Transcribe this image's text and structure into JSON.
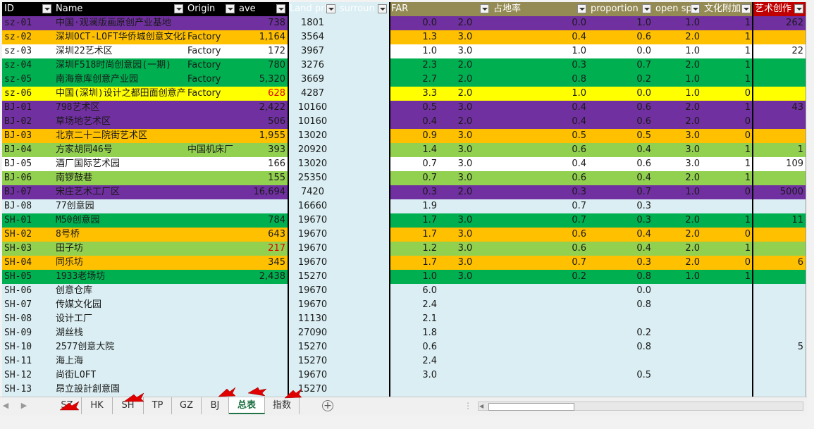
{
  "colors": {
    "purple": "#7030a0",
    "orange": "#ffc000",
    "white": "#ffffff",
    "green": "#00b050",
    "yellow": "#ffff00",
    "light_green": "#92d050",
    "light_blue": "#daeef3",
    "header_black": "#000000",
    "header_olive": "#948a54",
    "header_darkred": "#c00000",
    "red_text": "#e00000"
  },
  "headers": [
    {
      "label": "ID",
      "bg": "#000000",
      "filter": true
    },
    {
      "label": "Name",
      "bg": "#000000",
      "filter": true
    },
    {
      "label": "Origin",
      "bg": "#000000",
      "filter": true
    },
    {
      "label": "ave",
      "bg": "#000000",
      "filter": true
    },
    {
      "label": "Land pric",
      "bg": "#daeef3",
      "filter": true
    },
    {
      "label": "surroun",
      "bg": "#daeef3",
      "filter": true
    },
    {
      "label": "FAR",
      "bg": "#948a54",
      "filter": false
    },
    {
      "label": "",
      "bg": "#948a54",
      "filter": true
    },
    {
      "label": "占地率",
      "bg": "#948a54",
      "filter": true
    },
    {
      "label": "proportion",
      "bg": "#948a54",
      "filter": true
    },
    {
      "label": "open sp",
      "bg": "#948a54",
      "filter": true
    },
    {
      "label": "文化附加",
      "bg": "#948a54",
      "filter": true
    },
    {
      "label": "艺术创作",
      "bg": "#c00000",
      "filter": true
    }
  ],
  "rows": [
    {
      "bg": "#7030a0",
      "cells": [
        "sz-01",
        "中国·观澜版画原创产业基地",
        "",
        "738",
        "1801",
        "",
        "0.0",
        "2.0",
        "0.0",
        "1.0",
        "1.0",
        "1",
        "262"
      ]
    },
    {
      "bg": "#ffc000",
      "cells": [
        "sz-02",
        "深圳OCT-LOFT华侨城创意文化园",
        "Factory",
        "1,164",
        "3564",
        "",
        "1.3",
        "3.0",
        "0.4",
        "0.6",
        "2.0",
        "1",
        ""
      ]
    },
    {
      "bg": "#ffffff",
      "cells": [
        "sz-03",
        "深圳22艺术区",
        "Factory",
        "172",
        "3967",
        "",
        "1.0",
        "3.0",
        "1.0",
        "0.0",
        "1.0",
        "1",
        "22"
      ]
    },
    {
      "bg": "#00b050",
      "cells": [
        "sz-04",
        "深圳F518时尚创意园(一期)",
        "Factory",
        "780",
        "3276",
        "",
        "2.3",
        "2.0",
        "0.3",
        "0.7",
        "2.0",
        "1",
        ""
      ]
    },
    {
      "bg": "#00b050",
      "cells": [
        "sz-05",
        "南海意库创意产业园",
        "Factory",
        "5,320",
        "3669",
        "",
        "2.7",
        "2.0",
        "0.8",
        "0.2",
        "1.0",
        "1",
        ""
      ]
    },
    {
      "bg": "#ffff00",
      "red": [
        3
      ],
      "cells": [
        "sz-06",
        "中国(深圳)设计之都田面创意产业园",
        "Factory",
        "628",
        "4287",
        "",
        "3.3",
        "2.0",
        "1.0",
        "0.0",
        "1.0",
        "0",
        ""
      ]
    },
    {
      "bg": "#7030a0",
      "cells": [
        "BJ-01",
        "798艺术区",
        "",
        "2,422",
        "10160",
        "",
        "0.5",
        "3.0",
        "0.4",
        "0.6",
        "2.0",
        "1",
        "43"
      ]
    },
    {
      "bg": "#7030a0",
      "cells": [
        "BJ-02",
        "草场地艺术区",
        "",
        "506",
        "10160",
        "",
        "0.4",
        "2.0",
        "0.4",
        "0.6",
        "2.0",
        "0",
        ""
      ]
    },
    {
      "bg": "#ffc000",
      "cells": [
        "BJ-03",
        "北京二十二院街艺术区",
        "",
        "1,955",
        "13020",
        "",
        "0.9",
        "3.0",
        "0.5",
        "0.5",
        "3.0",
        "0",
        ""
      ]
    },
    {
      "bg": "#92d050",
      "cells": [
        "BJ-04",
        "方家胡同46号",
        "中国机床厂",
        "393",
        "20920",
        "",
        "1.4",
        "3.0",
        "0.6",
        "0.4",
        "3.0",
        "1",
        "1"
      ]
    },
    {
      "bg": "#ffffff",
      "cells": [
        "BJ-05",
        "酒厂国际艺术园",
        "",
        "166",
        "13020",
        "",
        "0.7",
        "3.0",
        "0.4",
        "0.6",
        "3.0",
        "1",
        "109"
      ]
    },
    {
      "bg": "#92d050",
      "cells": [
        "BJ-06",
        "南锣鼓巷",
        "",
        "155",
        "25350",
        "",
        "0.7",
        "3.0",
        "0.6",
        "0.4",
        "2.0",
        "1",
        ""
      ]
    },
    {
      "bg": "#7030a0",
      "cells": [
        "BJ-07",
        "宋庄艺术工厂区",
        "",
        "16,694",
        "7420",
        "",
        "0.3",
        "2.0",
        "0.3",
        "0.7",
        "1.0",
        "0",
        "5000"
      ]
    },
    {
      "bg": "#daeef3",
      "cells": [
        "BJ-08",
        "77创意园",
        "",
        "",
        "16660",
        "",
        "1.9",
        "",
        "0.7",
        "0.3",
        "",
        "",
        ""
      ]
    },
    {
      "bg": "#00b050",
      "cells": [
        "SH-01",
        "M50创意园",
        "",
        "784",
        "19670",
        "",
        "1.7",
        "3.0",
        "0.7",
        "0.3",
        "2.0",
        "1",
        "11"
      ]
    },
    {
      "bg": "#ffc000",
      "cells": [
        "SH-02",
        "8号桥",
        "",
        "643",
        "19670",
        "",
        "1.7",
        "3.0",
        "0.6",
        "0.4",
        "2.0",
        "0",
        ""
      ]
    },
    {
      "bg": "#92d050",
      "red": [
        3
      ],
      "cells": [
        "SH-03",
        "田子坊",
        "",
        "217",
        "19670",
        "",
        "1.2",
        "3.0",
        "0.6",
        "0.4",
        "2.0",
        "1",
        ""
      ]
    },
    {
      "bg": "#ffc000",
      "cells": [
        "SH-04",
        "同乐坊",
        "",
        "345",
        "19670",
        "",
        "1.7",
        "3.0",
        "0.7",
        "0.3",
        "2.0",
        "0",
        "6"
      ]
    },
    {
      "bg": "#00b050",
      "cells": [
        "SH-05",
        "1933老场坊",
        "",
        "2,438",
        "15270",
        "",
        "1.0",
        "3.0",
        "0.2",
        "0.8",
        "1.0",
        "1",
        ""
      ]
    },
    {
      "bg": "#daeef3",
      "cells": [
        "SH-06",
        "创意仓库",
        "",
        "",
        "19670",
        "",
        "6.0",
        "",
        "",
        "0.0",
        "",
        "",
        ""
      ]
    },
    {
      "bg": "#daeef3",
      "cells": [
        "SH-07",
        "传媒文化园",
        "",
        "",
        "19670",
        "",
        "2.4",
        "",
        "",
        "0.8",
        "",
        "",
        ""
      ]
    },
    {
      "bg": "#daeef3",
      "cells": [
        "SH-08",
        "设计工厂",
        "",
        "",
        "11130",
        "",
        "2.1",
        "",
        "",
        "",
        "",
        "",
        ""
      ]
    },
    {
      "bg": "#daeef3",
      "cells": [
        "SH-09",
        "湖丝栈",
        "",
        "",
        "27090",
        "",
        "1.8",
        "",
        "",
        "0.2",
        "",
        "",
        ""
      ]
    },
    {
      "bg": "#daeef3",
      "cells": [
        "SH-10",
        "2577创意大院",
        "",
        "",
        "15270",
        "",
        "0.6",
        "",
        "",
        "0.8",
        "",
        "",
        "5"
      ]
    },
    {
      "bg": "#daeef3",
      "cells": [
        "SH-11",
        "海上海",
        "",
        "",
        "15270",
        "",
        "2.4",
        "",
        "",
        "",
        "",
        "",
        ""
      ]
    },
    {
      "bg": "#daeef3",
      "cells": [
        "SH-12",
        "尚街LOFT",
        "",
        "",
        "19670",
        "",
        "3.0",
        "",
        "",
        "0.5",
        "",
        "",
        ""
      ]
    },
    {
      "bg": "#daeef3",
      "cells": [
        "SH-13",
        "昂立設計創意園",
        "",
        "",
        "15270",
        "",
        "",
        "",
        "",
        "",
        "",
        "",
        ""
      ]
    }
  ],
  "tabs": [
    {
      "label": "SZ",
      "active": false
    },
    {
      "label": "HK",
      "active": false
    },
    {
      "label": "SH",
      "active": false
    },
    {
      "label": "TP",
      "active": false
    },
    {
      "label": "GZ",
      "active": false
    },
    {
      "label": "BJ",
      "active": false
    },
    {
      "label": "总表",
      "active": true
    },
    {
      "label": "指数",
      "active": false
    }
  ],
  "icons": {
    "prev_sheet": "chevron-left-icon",
    "next_sheet": "chevron-right-icon",
    "add_sheet": "plus-circle-icon",
    "scroll_options": "vertical-dots-icon"
  }
}
